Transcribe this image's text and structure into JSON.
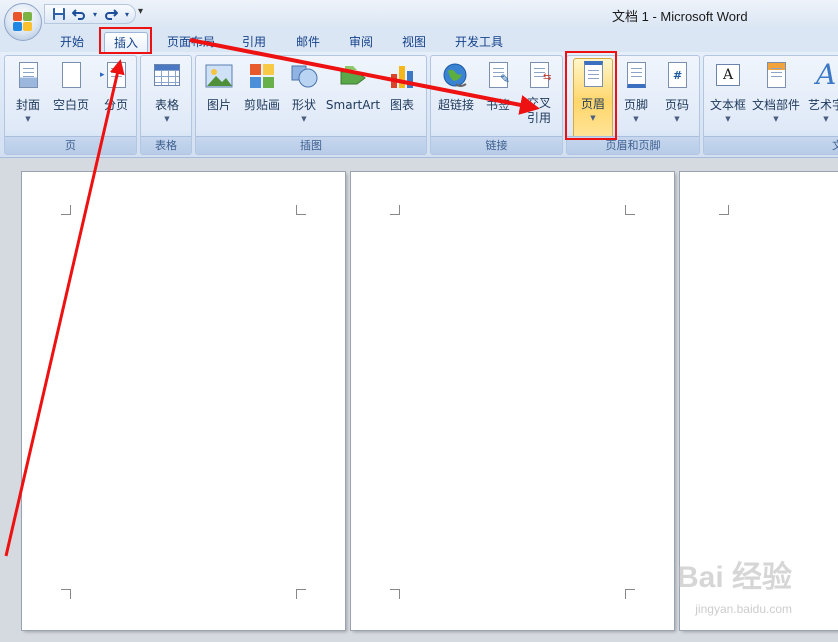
{
  "window": {
    "title": "文档 1 - Microsoft Word"
  },
  "qat": {
    "more": "▾"
  },
  "tabs": [
    "开始",
    "插入",
    "页面布局",
    "引用",
    "邮件",
    "审阅",
    "视图",
    "开发工具"
  ],
  "active_tab": "插入",
  "groups": {
    "page": {
      "label": "页",
      "buttons": [
        "封面",
        "空白页",
        "分页"
      ]
    },
    "table": {
      "label": "表格",
      "buttons": [
        "表格"
      ]
    },
    "illustrations": {
      "label": "插图",
      "buttons": [
        "图片",
        "剪贴画",
        "形状",
        "SmartArt",
        "图表"
      ]
    },
    "links": {
      "label": "链接",
      "buttons": [
        "超链接",
        "书签",
        "交叉",
        "引用"
      ]
    },
    "header_footer": {
      "label": "页眉和页脚",
      "buttons": [
        "页眉",
        "页脚",
        "页码"
      ]
    },
    "text": {
      "label": "文",
      "buttons": [
        "文本框",
        "文档部件",
        "艺术字"
      ]
    }
  },
  "watermark": {
    "text": "Bai 经验",
    "sub": "jingyan.baidu.com"
  },
  "colors": {
    "annotation": "#ee1111",
    "accent": "#15428b",
    "selected": "#ffd66b"
  }
}
